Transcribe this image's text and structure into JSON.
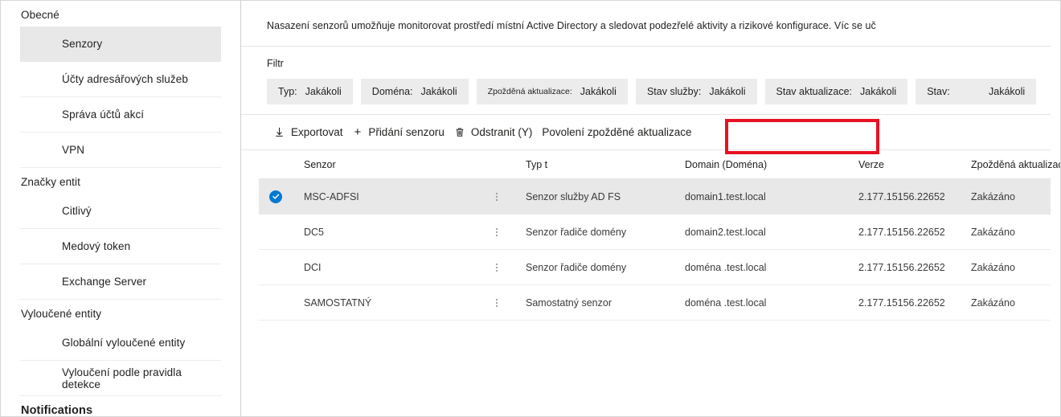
{
  "sidebar": {
    "groups": [
      {
        "title": "Obecné",
        "bold": false,
        "items": [
          {
            "label": "Senzory",
            "selected": true
          },
          {
            "label": "Účty adresářových služeb",
            "selected": false
          },
          {
            "label": "Správa účtů akcí",
            "selected": false
          },
          {
            "label": "VPN",
            "selected": false
          }
        ]
      },
      {
        "title": "Značky entit",
        "bold": false,
        "items": [
          {
            "label": "Citlivý",
            "selected": false
          },
          {
            "label": "Medový token",
            "selected": false
          },
          {
            "label": "Exchange Server",
            "selected": false
          }
        ]
      },
      {
        "title": "Vyloučené entity",
        "bold": false,
        "items": [
          {
            "label": "Globální vyloučené entity",
            "selected": false
          },
          {
            "label": "Vyloučení podle pravidla detekce",
            "selected": false
          }
        ]
      },
      {
        "title": "Notifications",
        "bold": true,
        "items": []
      }
    ]
  },
  "main": {
    "intro": "Nasazení senzorů umožňuje monitorovat prostředí místní Active Directory a sledovat podezřelé aktivity a rizikové konfigurace. Víc se uč",
    "filter": {
      "label": "Filtr",
      "pills": [
        {
          "key": "Typ:",
          "value": "Jakákoli"
        },
        {
          "key": "Doména:",
          "value": "Jakákoli"
        },
        {
          "key": "Zpožděná aktualizace:",
          "value": "Jakákoli"
        },
        {
          "key": "Stav služby:",
          "value": "Jakákoli"
        },
        {
          "key": "Stav aktualizace:",
          "value": "Jakákoli"
        },
        {
          "key": "Stav:",
          "value": "Jakákoli"
        }
      ]
    },
    "toolbar": {
      "export_label": "Exportovat",
      "add_sensor_label": "Přidání senzoru",
      "delete_label": "Odstranit (Y)",
      "enable_delayed_label": "Povolení zpožděné aktualizace",
      "highlight_color": "#e81123"
    },
    "table": {
      "headers": {
        "sensor": "Senzor",
        "type": "Typ t",
        "domain": "Domain (Doména)",
        "version": "Verze",
        "delayed_update": "Zpožděná aktualizace"
      },
      "rows": [
        {
          "selected": true,
          "sensor": "MSC-ADFSI",
          "type": "Senzor služby AD FS",
          "domain": "domain1.test.local",
          "version": "2.177.15156.22652",
          "delayed_update": "Zakázáno"
        },
        {
          "selected": false,
          "sensor": "DC5",
          "type": "Senzor řadiče domény",
          "domain": "domain2.test.local",
          "version": "2.177.15156.22652",
          "delayed_update": "Zakázáno"
        },
        {
          "selected": false,
          "sensor": "DCI",
          "type": "Senzor řadiče domény",
          "domain": "doména .test.local",
          "version": "2.177.15156.22652",
          "delayed_update": "Zakázáno"
        },
        {
          "selected": false,
          "sensor": "SAMOSTATNÝ",
          "type": "Samostatný senzor",
          "domain": "doména .test.local",
          "version": "2.177.15156.22652",
          "delayed_update": "Zakázáno"
        }
      ]
    }
  },
  "colors": {
    "accent": "#0078d4",
    "selected_row": "#e8e8e8",
    "highlight": "#e81123"
  }
}
